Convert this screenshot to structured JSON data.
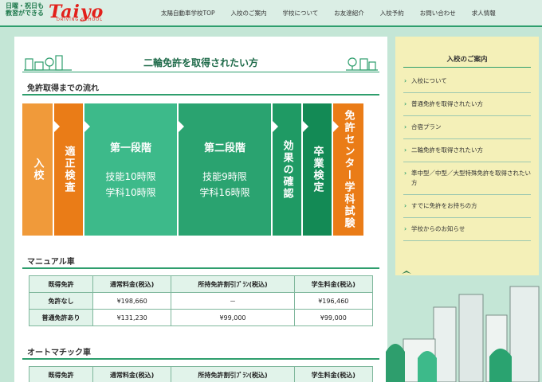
{
  "header": {
    "logo_small": "日曜・祝日も\n教習ができる",
    "logo_big": "Taiyo",
    "logo_sub": "DRIVING SCHOOL",
    "nav": [
      "太陽自動車学校TOP",
      "入校のご案内",
      "学校について",
      "お友達紹介",
      "入校予約",
      "お問い合わせ",
      "求人情報"
    ]
  },
  "page_title": "二輪免許を取得されたい方",
  "flow_section": {
    "title": "免許取得までの流れ",
    "steps": [
      {
        "label": "入校",
        "color": "#f09a3a"
      },
      {
        "label": "適正検査",
        "color": "#ea7c17"
      },
      {
        "label": "第一段階",
        "lines": [
          "技能10時限",
          "学科10時限"
        ],
        "color": "#3dba8a"
      },
      {
        "label": "第二段階",
        "lines": [
          "技能9時限",
          "学科16時限"
        ],
        "color": "#2aa370"
      },
      {
        "label": "効果の確認",
        "color": "#1f9a64"
      },
      {
        "label": "卒業検定",
        "color": "#138a55"
      },
      {
        "label": "免許センター学科試験",
        "color": "#ea7c17"
      }
    ]
  },
  "manual": {
    "title": "マニュアル車",
    "headers": [
      "既得免許",
      "通常料金(税込)",
      "所持免許割引ﾌﾟﾗﾝ(税込)",
      "学生料金(税込)"
    ],
    "rows": [
      [
        "免許なし",
        "¥198,660",
        "－",
        "¥196,460"
      ],
      [
        "普通免許あり",
        "¥131,230",
        "¥99,000",
        "¥99,000"
      ]
    ]
  },
  "automatic": {
    "title": "オートマチック車",
    "headers": [
      "既得免許",
      "通常料金(税込)",
      "所持免許割引ﾌﾟﾗﾝ(税込)",
      "学生料金(税込)"
    ]
  },
  "sidebar": {
    "title": "入校のご案内",
    "items": [
      "入校について",
      "普通免許を取得されたい方",
      "合宿プラン",
      "二輪免許を取得されたい方",
      "準中型／中型／大型特殊免許を取得されたい方",
      "すでに免許をお持ちの方",
      "学校からのお知らせ"
    ]
  },
  "colors": {
    "accent": "#2e9e6d",
    "brand": "#e2201b",
    "sidebar_bg": "#f4f0b8",
    "page_bg": "#c4e6d6"
  }
}
